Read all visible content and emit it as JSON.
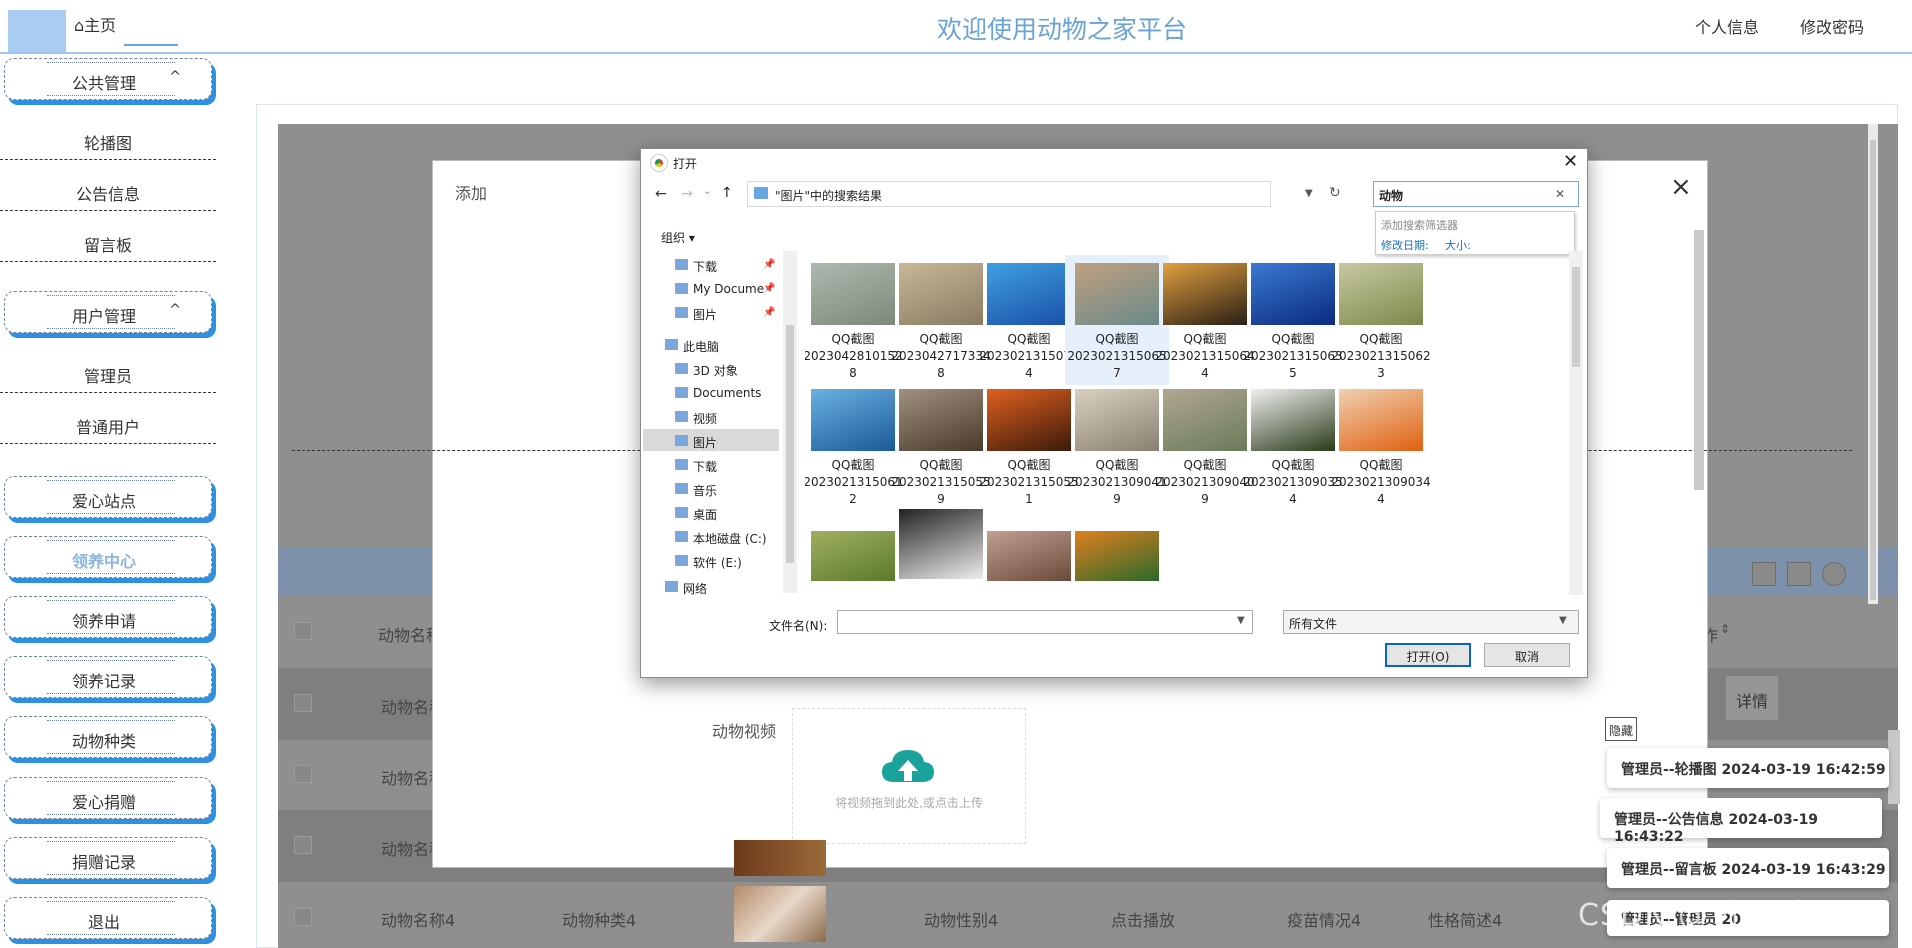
{
  "header": {
    "home": "⌂主页",
    "title": "欢迎使用动物之家平台",
    "profile": "个人信息",
    "change_password": "修改密码"
  },
  "sidebar": {
    "public_mgmt": "公共管理",
    "carousel": "轮播图",
    "notice": "公告信息",
    "message_board": "留言板",
    "user_mgmt": "用户管理",
    "admin": "管理员",
    "normal_user": "普通用户",
    "love_station": "爱心站点",
    "adoption_center": "领养中心",
    "adoption_apply": "领养申请",
    "adoption_record": "领养记录",
    "animal_species": "动物种类",
    "love_donation": "爱心捐赠",
    "donation_record": "捐赠记录",
    "logout": "退出",
    "chev_up": "^"
  },
  "table": {
    "col_name": "动物名称",
    "col_tail": "作",
    "r1_name": "动物名称",
    "r2_name": "动物名称",
    "r3_name": "动物名称",
    "r4": [
      "动物名称4",
      "动物种类4",
      "动物性别4",
      "点击播放",
      "疫苗情况4",
      "性格简述4"
    ],
    "detail": "详情"
  },
  "modal": {
    "title": "添加",
    "close": "×",
    "video_label": "动物视频",
    "upload_hint": "将视频拖到此处,或点击上传"
  },
  "file_dialog": {
    "title": "打开",
    "address": "\"图片\"中的搜索结果",
    "search_value": "动物",
    "filter_title": "添加搜索筛选器",
    "filter_date": "修改日期:",
    "filter_size": "大小:",
    "organize": "组织 ▾",
    "nav": [
      "下载",
      "My Docume",
      "图片",
      "此电脑",
      "3D 对象",
      "Documents",
      "视频",
      "图片",
      "下载",
      "音乐",
      "桌面",
      "本地磁盘 (C:)",
      "软件 (E:)",
      "网络"
    ],
    "files": [
      {
        "l1": "QQ截图",
        "l2": "2023042810152",
        "l3": "8"
      },
      {
        "l1": "QQ截图",
        "l2": "2023042717334",
        "l3": "8"
      },
      {
        "l1": "QQ截图",
        "l2": "2023021315073",
        "l3": "4"
      },
      {
        "l1": "QQ截图",
        "l2": "2023021315065",
        "l3": "7"
      },
      {
        "l1": "QQ截图",
        "l2": "2023021315064",
        "l3": "4"
      },
      {
        "l1": "QQ截图",
        "l2": "2023021315063",
        "l3": "5"
      },
      {
        "l1": "QQ截图",
        "l2": "2023021315062",
        "l3": "3"
      },
      {
        "l1": "QQ截图",
        "l2": "2023021315061",
        "l3": "2"
      },
      {
        "l1": "QQ截图",
        "l2": "2023021315055",
        "l3": "9"
      },
      {
        "l1": "QQ截图",
        "l2": "2023021315055",
        "l3": "1"
      },
      {
        "l1": "QQ截图",
        "l2": "2023021309041",
        "l3": "9"
      },
      {
        "l1": "QQ截图",
        "l2": "2023021309040",
        "l3": "9"
      },
      {
        "l1": "QQ截图",
        "l2": "2023021309035",
        "l3": "4"
      },
      {
        "l1": "QQ截图",
        "l2": "2023021309034",
        "l3": "4"
      }
    ],
    "filename_label": "文件名(N):",
    "filename_value": "",
    "filetype": "所有文件",
    "open_btn": "打开(O)",
    "cancel_btn": "取消"
  },
  "notifications": {
    "hide": "隐藏",
    "items": [
      "管理员--轮播图 2024-03-19 16:42:59",
      "管理员--公告信息 2024-03-19 16:43:22",
      "管理员--留言板 2024-03-19 16:43:29",
      "管理员--管理员 20"
    ]
  },
  "watermark": "CSDN @ 小程序员"
}
